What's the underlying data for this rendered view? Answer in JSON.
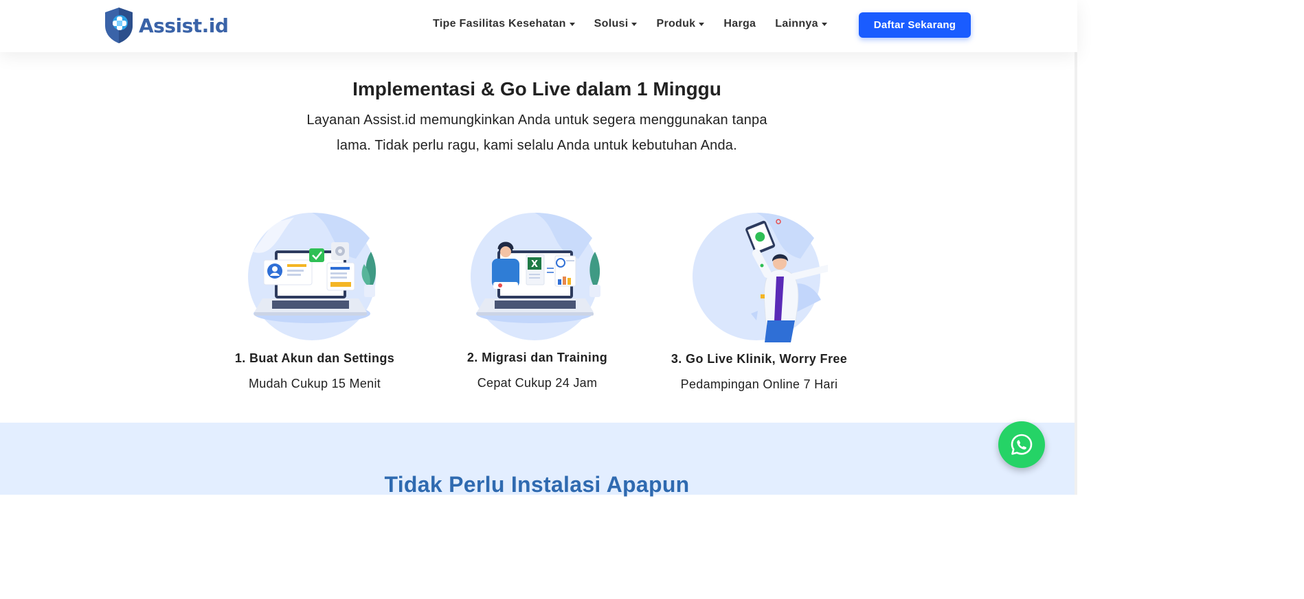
{
  "brand": {
    "name": "Assist.id",
    "color": "#3a63a8"
  },
  "nav": {
    "items": [
      {
        "label": "Tipe Fasilitas Kesehatan",
        "dropdown": true
      },
      {
        "label": "Solusi",
        "dropdown": true
      },
      {
        "label": "Produk",
        "dropdown": true
      },
      {
        "label": "Harga",
        "dropdown": false
      },
      {
        "label": "Lainnya",
        "dropdown": true
      }
    ],
    "cta_label": "Daftar Sekarang",
    "cta_color": "#1a5cff"
  },
  "hero": {
    "title": "Implementasi & Go Live dalam 1 Minggu",
    "desc_line1": "Layanan Assist.id memungkinkan Anda untuk segera menggunakan tanpa",
    "desc_line2": "lama. Tidak perlu ragu, kami selalu Anda untuk kebutuhan Anda."
  },
  "steps": [
    {
      "title": "1. Buat Akun dan Settings",
      "subtitle": "Mudah Cukup 15 Menit",
      "icon": "laptop-account-illustration"
    },
    {
      "title": "2. Migrasi dan Training",
      "subtitle": "Cepat Cukup 24 Jam",
      "icon": "laptop-support-illustration"
    },
    {
      "title": "3. Go Live Klinik, Worry Free",
      "subtitle": "Pedampingan Online 7 Hari",
      "icon": "doctor-celebrate-illustration"
    }
  ],
  "section2": {
    "title": "Tidak Perlu Instalasi Apapun",
    "band_color": "#e3eeff"
  },
  "whatsapp": {
    "icon": "whatsapp-icon",
    "color": "#25d366"
  }
}
